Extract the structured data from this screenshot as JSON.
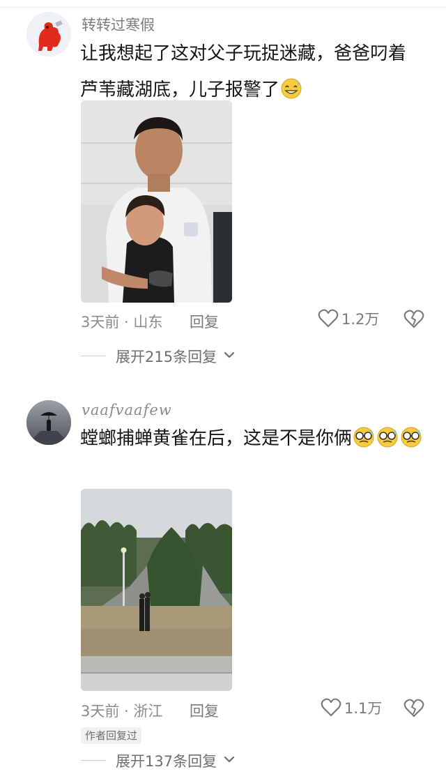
{
  "comments": [
    {
      "username": "转转过寒假",
      "text": "让我想起了这对父子玩捉迷藏，爸爸叼着芦苇藏湖底，儿子报警了",
      "time_location": "3天前 · 山东",
      "reply_label": "回复",
      "likes": "1.2万",
      "expand_label": "展开215条回复",
      "emoji": "grinning-sweat-emoji"
    },
    {
      "username": "vaafvaafew",
      "text": "螳螂捕蝉黄雀在后，这是不是你俩",
      "time_location": "3天前 · 浙江",
      "reply_label": "回复",
      "likes": "1.1万",
      "author_badge": "作者回复过",
      "expand_label": "展开137条回复",
      "emoji": "nerd-sweat-emoji"
    }
  ],
  "colors": {
    "text": "#151515",
    "meta": "#8c8c8c",
    "badge_bg": "#f1f1f1"
  },
  "icons": [
    "heart-outline-icon",
    "broken-heart-icon",
    "chevron-down-icon"
  ]
}
